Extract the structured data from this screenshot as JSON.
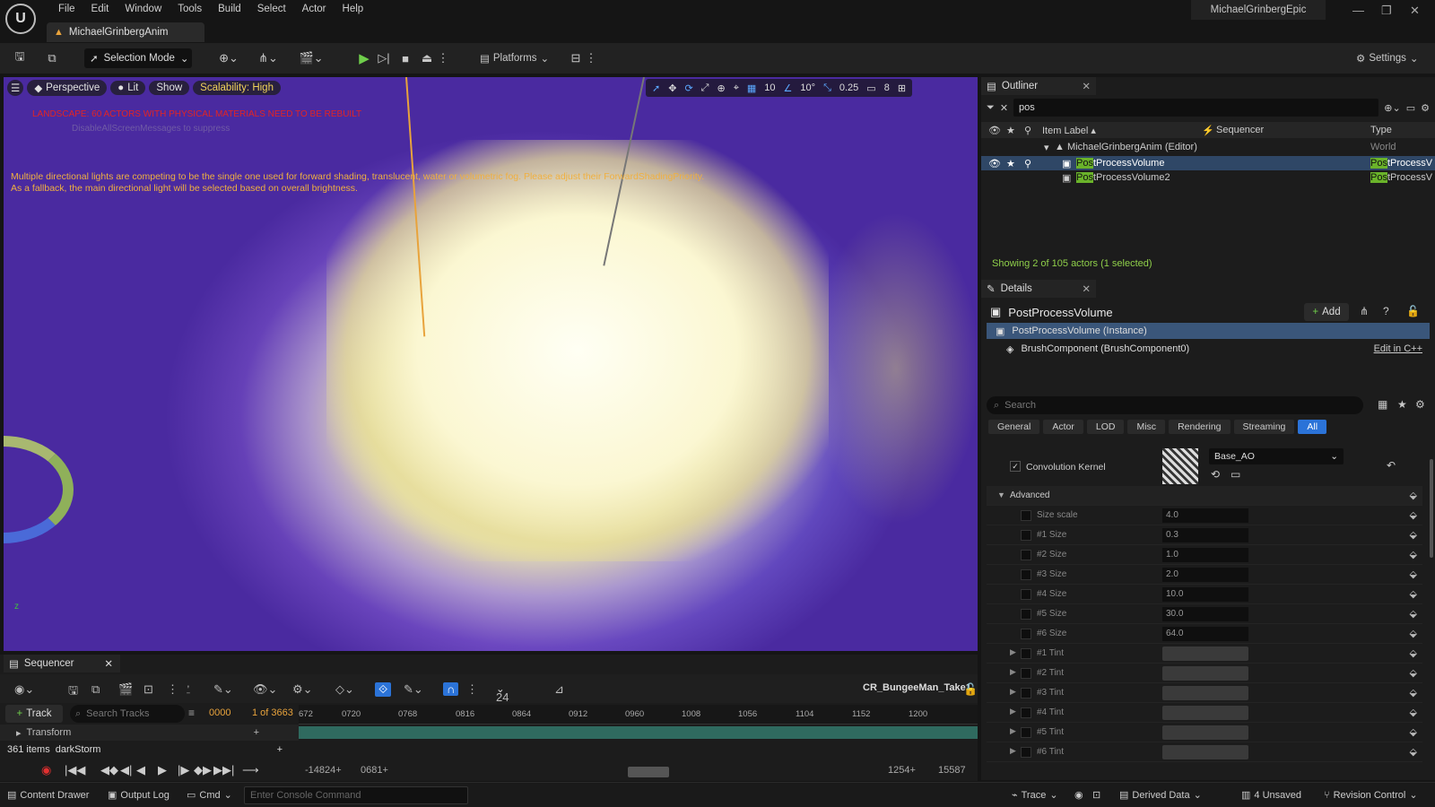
{
  "app": {
    "logo": "U",
    "project_tab": "MichaelGrinbergAnim",
    "account": "MichaelGrinbergEpic"
  },
  "menu": [
    "File",
    "Edit",
    "Window",
    "Tools",
    "Build",
    "Select",
    "Actor",
    "Help"
  ],
  "toolbar": {
    "selection_mode": "Selection Mode",
    "platforms": "Platforms",
    "settings": "Settings"
  },
  "viewport": {
    "perspective": "Perspective",
    "lit": "Lit",
    "show": "Show",
    "scalability": "Scalability: High",
    "grid_snap": "10",
    "rot_snap": "10°",
    "scale_snap": "0.25",
    "cam_speed": "8",
    "landscape_warning": "LANDSCAPE: 60 ACTORS WITH PHYSICAL MATERIALS NEED TO BE REBUILT",
    "ghost_text": "DisableAllScreenMessages to suppress",
    "light_warning_1": "Multiple directional lights are competing to be the single one used for forward shading, translucent, water or volumetric fog. Please adjust their ForwardShadingPriority.",
    "light_warning_2": "As a fallback, the main directional light will be selected based on overall brightness.",
    "axis": "z"
  },
  "sequencer": {
    "tab": "Sequencer",
    "fps": "24 fps",
    "take": "CR_BungeeMan_Take1",
    "add_track": "Track",
    "search_placeholder": "Search Tracks",
    "frame": "0000",
    "of_frames": "1 of 3663",
    "ticks": [
      "672",
      "0720",
      "0768",
      "0816",
      "0864",
      "0912",
      "0960",
      "1008",
      "1056",
      "1104",
      "1152",
      "1200"
    ],
    "track": "Transform",
    "items": "361 items",
    "item_name": "darkStorm",
    "range_start": "-14824+",
    "range_cur": "0681+",
    "range_end1": "1254+",
    "range_end2": "15587"
  },
  "status": {
    "content_drawer": "Content Drawer",
    "output_log": "Output Log",
    "cmd": "Cmd",
    "console_placeholder": "Enter Console Command",
    "trace": "Trace",
    "derived": "Derived Data",
    "unsaved": "4 Unsaved",
    "revision": "Revision Control"
  },
  "outliner": {
    "tab": "Outliner",
    "search": "pos",
    "col_label": "Item Label",
    "col_seq": "Sequencer",
    "col_type": "Type",
    "world": "MichaelGrinbergAnim (Editor)",
    "world_type": "World",
    "rows": [
      {
        "hl": "Pos",
        "rest": "tProcessVolume",
        "type_hl": "Pos",
        "type_rest": "tProcessV"
      },
      {
        "hl": "Pos",
        "rest": "tProcessVolume2",
        "type_hl": "Pos",
        "type_rest": "tProcessV"
      }
    ],
    "showing": "Showing 2 of 105 actors (1 selected)"
  },
  "details": {
    "tab": "Details",
    "title": "PostProcessVolume",
    "add": "Add",
    "instance": "PostProcessVolume (Instance)",
    "brush": "BrushComponent (BrushComponent0)",
    "edit_cpp": "Edit in C++",
    "search_placeholder": "Search",
    "filters": [
      "General",
      "Actor",
      "LOD",
      "Misc",
      "Rendering",
      "Streaming",
      "All"
    ],
    "kernel_label": "Convolution Kernel",
    "kernel_value": "Base_AO",
    "advanced": "Advanced",
    "props": [
      {
        "label": "Size scale",
        "value": "4.0"
      },
      {
        "label": "#1 Size",
        "value": "0.3"
      },
      {
        "label": "#2 Size",
        "value": "1.0"
      },
      {
        "label": "#3 Size",
        "value": "2.0"
      },
      {
        "label": "#4 Size",
        "value": "10.0"
      },
      {
        "label": "#5 Size",
        "value": "30.0"
      },
      {
        "label": "#6 Size",
        "value": "64.0"
      }
    ],
    "tints": [
      "#1 Tint",
      "#2 Tint",
      "#3 Tint",
      "#4 Tint",
      "#5 Tint",
      "#6 Tint"
    ]
  }
}
